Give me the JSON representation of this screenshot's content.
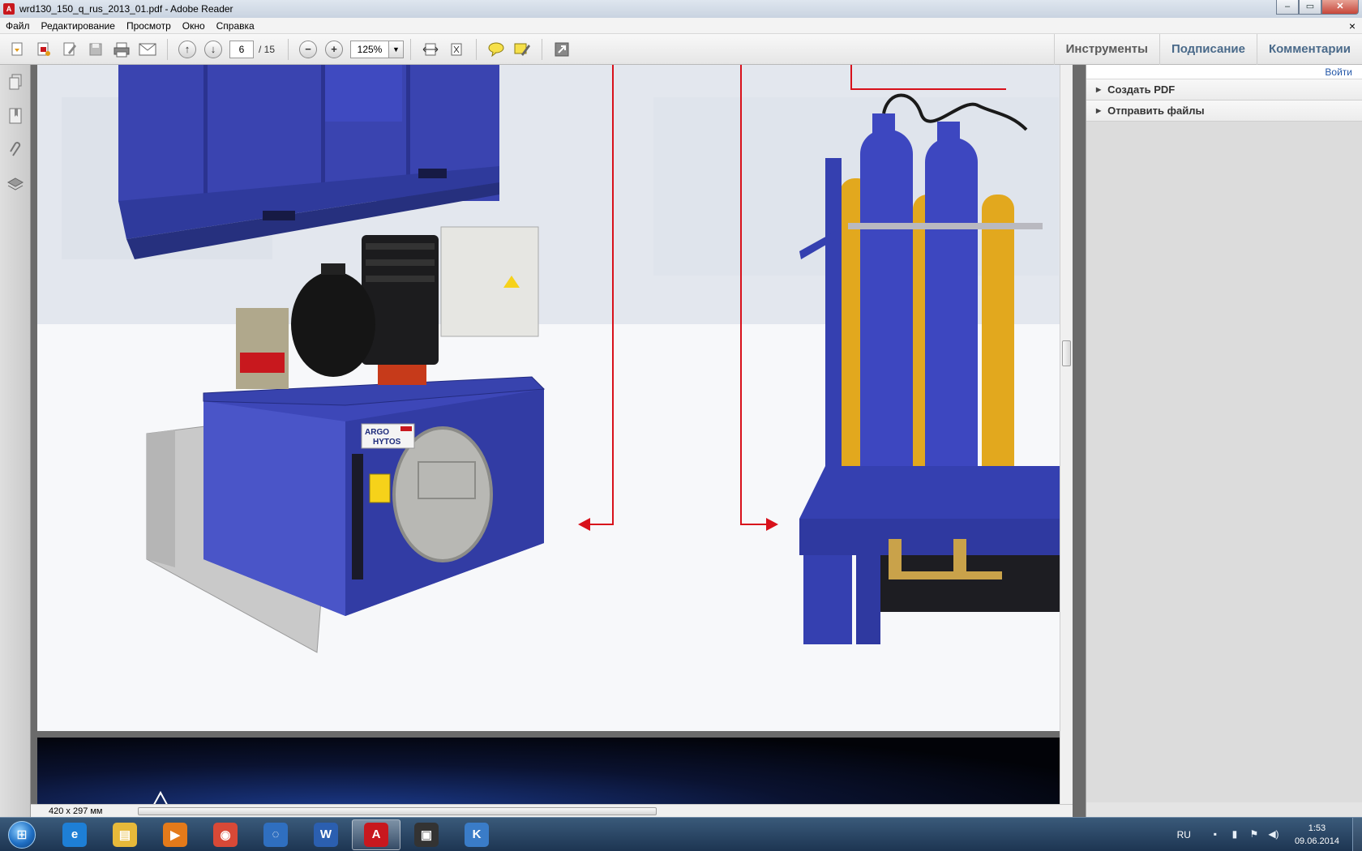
{
  "window": {
    "title": "wrd130_150_q_rus_2013_01.pdf - Adobe Reader",
    "app_icon": "pdf-icon",
    "controls": {
      "minimize": "‒",
      "maximize": "▭",
      "close": "✕"
    }
  },
  "menu": {
    "items": [
      "Файл",
      "Редактирование",
      "Просмотр",
      "Окно",
      "Справка"
    ],
    "doc_close": "×"
  },
  "toolbar": {
    "current_page": "6",
    "total_pages": "/ 15",
    "zoom": "125%",
    "zoom_dropdown": "▼",
    "tabs": [
      "Инструменты",
      "Подписание",
      "Комментарии"
    ]
  },
  "right_panel": {
    "login": "Войти",
    "sections": [
      "Создать PDF",
      "Отправить файлы"
    ]
  },
  "page_content": {
    "logo_line1": "ARGO",
    "logo_line2": "HYTOS",
    "arrow_color": "#d8111b",
    "tank_color": "#3a3fa8",
    "accumulator_color": "#e8b020"
  },
  "status": {
    "page_size": "420 x 297 мм"
  },
  "taskbar": {
    "apps": [
      {
        "name": "internet-explorer",
        "glyph": "e",
        "color": "#1e7fd6"
      },
      {
        "name": "file-explorer",
        "glyph": "▤",
        "color": "#e7b93a"
      },
      {
        "name": "media-player",
        "glyph": "▶",
        "color": "#e47a1a"
      },
      {
        "name": "chrome",
        "glyph": "◉",
        "color": "#d84937"
      },
      {
        "name": "browser-swirl",
        "glyph": "◌",
        "color": "#2f6fc0"
      },
      {
        "name": "word",
        "glyph": "W",
        "color": "#2b5fb0"
      },
      {
        "name": "adobe-reader",
        "glyph": "A",
        "color": "#c8181e"
      },
      {
        "name": "pro-app",
        "glyph": "▣",
        "color": "#333"
      },
      {
        "name": "kompas",
        "glyph": "K",
        "color": "#3a7cc8"
      }
    ],
    "tray": {
      "lang": "RU",
      "time": "1:53",
      "date": "09.06.2014"
    }
  }
}
